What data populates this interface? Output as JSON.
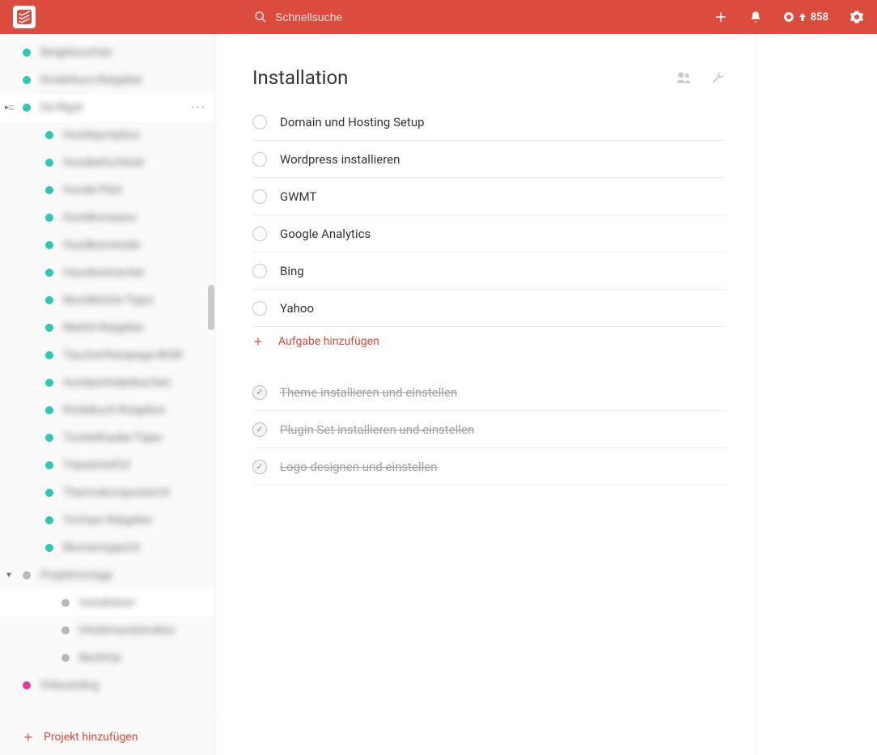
{
  "colors": {
    "accent": "#db4c3f"
  },
  "header": {
    "search_placeholder": "Schnellsuche",
    "karma_points": "858"
  },
  "sidebar": {
    "add_project_label": "Projekt hinzufügen",
    "items": [
      {
        "label": "Neighbourhub",
        "color": "teal"
      },
      {
        "label": "Kinderkurs-Ratgeber",
        "color": "teal"
      },
      {
        "label": "De-Rigid",
        "color": "teal",
        "selected": true,
        "caret": true,
        "handle": true,
        "more": true
      },
      {
        "label": "Hundejumpbox",
        "color": "teal",
        "child": true
      },
      {
        "label": "Hundbefuchtnet",
        "color": "teal",
        "child": true
      },
      {
        "label": "Hunde-Pilot",
        "color": "teal",
        "child": true
      },
      {
        "label": "Hundkompass",
        "color": "teal",
        "child": true
      },
      {
        "label": "Hundkamerade",
        "color": "teal",
        "child": true
      },
      {
        "label": "Hausbestnecker",
        "color": "teal",
        "child": true
      },
      {
        "label": "Mundküche-Tipps",
        "color": "teal",
        "child": true
      },
      {
        "label": "Marbit-Ratgeber",
        "color": "teal",
        "child": true
      },
      {
        "label": "Tauchertherapage-BGM",
        "color": "teal",
        "child": true
      },
      {
        "label": "Aundyenhelpdeschen",
        "color": "teal",
        "child": true
      },
      {
        "label": "Kindekuch-Rutgebot",
        "color": "teal",
        "child": true
      },
      {
        "label": "Trockelhaube-Tipps",
        "color": "teal",
        "child": true
      },
      {
        "label": "Tripedchef24",
        "color": "teal",
        "child": true
      },
      {
        "label": "Thermokomposter24",
        "color": "teal",
        "child": true
      },
      {
        "label": "Trichaer-Ratgeber",
        "color": "teal",
        "child": true
      },
      {
        "label": "Blumenrippe24",
        "color": "teal",
        "child": true
      },
      {
        "label": "Projektvorlage",
        "color": "grey",
        "caret": true,
        "caret_open": true
      },
      {
        "label": "Installation",
        "color": "grey",
        "grandchild": true,
        "selected": true
      },
      {
        "label": "Inhaltmandstruktur",
        "color": "grey",
        "grandchild": true
      },
      {
        "label": "Backtrip",
        "color": "grey",
        "grandchild": true
      },
      {
        "label": "Onboarding",
        "color": "pink"
      }
    ]
  },
  "main": {
    "title": "Installation",
    "add_task_label": "Aufgabe hinzufügen",
    "tasks": [
      {
        "text": "Domain und Hosting Setup",
        "done": false
      },
      {
        "text": "Wordpress installieren",
        "done": false
      },
      {
        "text": "GWMT",
        "done": false
      },
      {
        "text": "Google Analytics",
        "done": false
      },
      {
        "text": "Bing",
        "done": false
      },
      {
        "text": "Yahoo",
        "done": false
      }
    ],
    "tasks_done": [
      {
        "text": "Theme installieren und einstellen",
        "done": true
      },
      {
        "text": "Plugin Set installieren und einstellen",
        "done": true
      },
      {
        "text": "Logo designen und einstellen",
        "done": true
      }
    ]
  }
}
